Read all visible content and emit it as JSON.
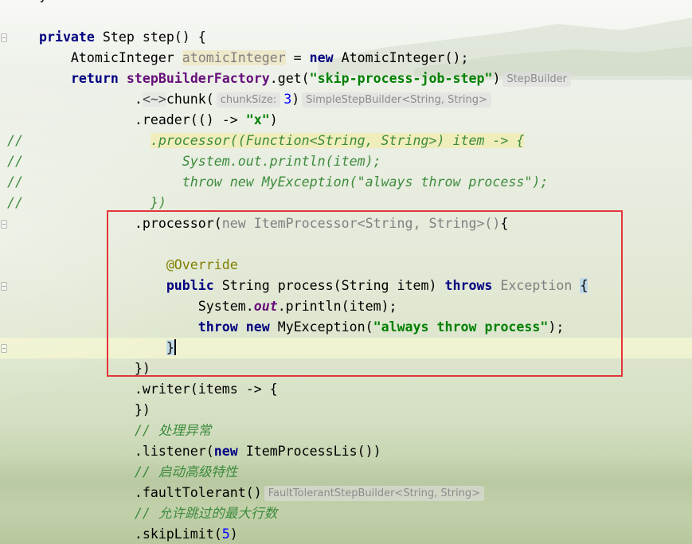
{
  "theme": {
    "keyword": "#000080",
    "field": "#660e7a",
    "string": "#008000",
    "number": "#0000ff",
    "annotation": "#808000",
    "comment": "#3d8b3d",
    "dimmed": "#808080",
    "annotation_box": "#e4353a"
  },
  "editor": {
    "lines": [
      {
        "tokens": [
          {
            "t": "    "
          },
          {
            "t": "}"
          }
        ]
      },
      {
        "tokens": []
      },
      {
        "fold": "start",
        "tokens": [
          {
            "t": "    "
          },
          {
            "t": "private",
            "k": "kw"
          },
          {
            "t": " Step step() {"
          }
        ]
      },
      {
        "tokens": [
          {
            "t": "        AtomicInteger "
          },
          {
            "t": "atomicInteger",
            "k": "unused"
          },
          {
            "t": " = "
          },
          {
            "t": "new",
            "k": "kw"
          },
          {
            "t": " AtomicInteger();"
          }
        ]
      },
      {
        "tokens": [
          {
            "t": "        "
          },
          {
            "t": "return",
            "k": "kw"
          },
          {
            "t": " "
          },
          {
            "t": "stepBuilderFactory",
            "k": "field"
          },
          {
            "t": ".get("
          },
          {
            "t": "\"skip-process-job-step\"",
            "k": "str"
          },
          {
            "t": ")"
          },
          {
            "t": "StepBuilder",
            "k": "hint"
          }
        ]
      },
      {
        "tokens": [
          {
            "t": "                ."
          },
          {
            "t": "<~>",
            "k": "fold"
          },
          {
            "t": "chunk("
          },
          {
            "t": "chunkSize:",
            "k": "hint"
          },
          {
            "t": "3",
            "k": "num"
          },
          {
            "t": ")"
          },
          {
            "t": "SimpleStepBuilder<String, String>",
            "k": "hint"
          }
        ]
      },
      {
        "tokens": [
          {
            "t": "                .reader(() -> "
          },
          {
            "t": "\"x\"",
            "k": "str"
          },
          {
            "t": ")"
          }
        ]
      },
      {
        "tokens": [
          {
            "t": "//                ",
            "k": "cmt"
          },
          {
            "t": ".processor((Function<String, String>) item -> {",
            "k": "cmt-hl"
          }
        ]
      },
      {
        "tokens": [
          {
            "t": "//                    System.out.println(item);",
            "k": "cmt"
          }
        ]
      },
      {
        "tokens": [
          {
            "t": "//                    throw new MyException(\"always throw process\");",
            "k": "cmt"
          }
        ]
      },
      {
        "tokens": [
          {
            "t": "//                })",
            "k": "cmt"
          }
        ]
      },
      {
        "fold": "start",
        "tokens": [
          {
            "t": "                .processor("
          },
          {
            "t": "new ItemProcessor<String, String>()",
            "k": "dim"
          },
          {
            "t": "{"
          }
        ]
      },
      {
        "tokens": []
      },
      {
        "tokens": [
          {
            "t": "                    "
          },
          {
            "t": "@Override",
            "k": "ann"
          }
        ]
      },
      {
        "fold": "start",
        "tokens": [
          {
            "t": "                    "
          },
          {
            "t": "public",
            "k": "kw"
          },
          {
            "t": " String process(String item) "
          },
          {
            "t": "throws",
            "k": "kw"
          },
          {
            "t": " "
          },
          {
            "t": "Exception",
            "k": "dim"
          },
          {
            "t": " "
          },
          {
            "t": "{",
            "k": "brace"
          }
        ]
      },
      {
        "tokens": [
          {
            "t": "                        System."
          },
          {
            "t": "out",
            "k": "static"
          },
          {
            "t": ".println(item);"
          }
        ]
      },
      {
        "tokens": [
          {
            "t": "                        "
          },
          {
            "t": "throw",
            "k": "kw"
          },
          {
            "t": " "
          },
          {
            "t": "new",
            "k": "kw"
          },
          {
            "t": " MyException("
          },
          {
            "t": "\"always throw process\"",
            "k": "str"
          },
          {
            "t": ");"
          }
        ]
      },
      {
        "current": true,
        "fold": "end",
        "tokens": [
          {
            "t": "                    "
          },
          {
            "t": "}",
            "k": "brace"
          },
          {
            "k": "caret"
          }
        ]
      },
      {
        "tokens": [
          {
            "t": "                })"
          }
        ]
      },
      {
        "tokens": [
          {
            "t": "                .writer(items -> {"
          }
        ]
      },
      {
        "tokens": [
          {
            "t": "                })"
          }
        ]
      },
      {
        "tokens": [
          {
            "t": "                "
          },
          {
            "t": "// 处理异常",
            "k": "cmt"
          }
        ]
      },
      {
        "tokens": [
          {
            "t": "                .listener("
          },
          {
            "t": "new",
            "k": "kw"
          },
          {
            "t": " ItemProcessLis())"
          }
        ]
      },
      {
        "tokens": [
          {
            "t": "                "
          },
          {
            "t": "// 启动高级特性",
            "k": "cmt"
          }
        ]
      },
      {
        "tokens": [
          {
            "t": "                .faultTolerant()"
          },
          {
            "t": "FaultTolerantStepBuilder<String, String>",
            "k": "hint"
          }
        ]
      },
      {
        "tokens": [
          {
            "t": "                "
          },
          {
            "t": "// 允许跳过的最大行数",
            "k": "cmt"
          }
        ]
      },
      {
        "tokens": [
          {
            "t": "                .skipLimit("
          },
          {
            "t": "5",
            "k": "num"
          },
          {
            "t": ")"
          }
        ]
      }
    ]
  }
}
